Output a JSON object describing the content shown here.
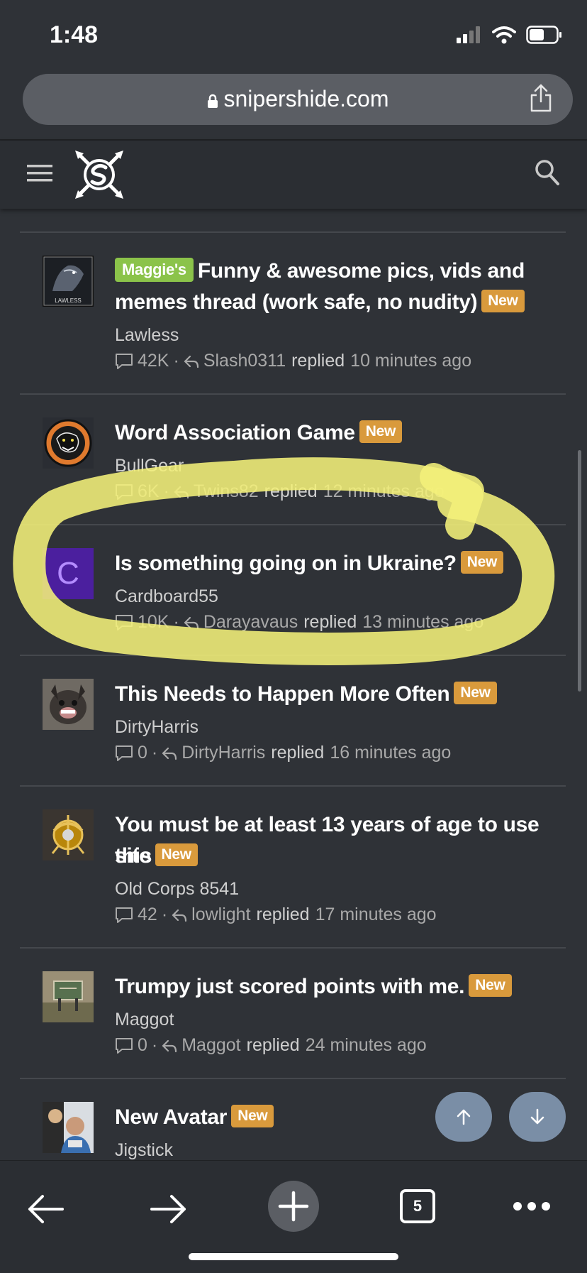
{
  "status_bar": {
    "time": "1:48"
  },
  "browser": {
    "url": "snipershide.com",
    "tabs_count": "5"
  },
  "threads": [
    {
      "prefix": "Maggie's",
      "title_line1": "Funny & awesome pics, vids and",
      "title_line2": "memes thread (work safe, no nudity)",
      "badge": "New",
      "starter": "Lawless",
      "replies": "42K",
      "last_poster": "Slash0311",
      "replied_label": "replied",
      "time": "10 minutes ago",
      "avatar_text": "LAWLESS"
    },
    {
      "title_line1": "Word Association Game",
      "badge": "New",
      "starter": "BullGear",
      "replies": "6K",
      "last_poster": "Twins82",
      "replied_label": "replied",
      "time": "12 minutes ago"
    },
    {
      "title_line1": "Is something going on in Ukraine?",
      "badge": "New",
      "starter": "Cardboard55",
      "replies": "10K",
      "last_poster": "Darayavaus",
      "replied_label": "replied",
      "time": "13 minutes ago",
      "avatar_letter": "C"
    },
    {
      "title_line1": "This Needs to Happen More Often",
      "badge": "New",
      "starter": "DirtyHarris",
      "replies": "0",
      "last_poster": "DirtyHarris",
      "replied_label": "replied",
      "time": "16 minutes ago"
    },
    {
      "title_line1": "You must be at least 13 years of age to use this",
      "title_line2": "site",
      "badge": "New",
      "starter": "Old Corps 8541",
      "replies": "42",
      "last_poster": "lowlight",
      "replied_label": "replied",
      "time": "17 minutes ago"
    },
    {
      "title_line1": "Trumpy just scored points with me.",
      "badge": "New",
      "starter": "Maggot",
      "replies": "0",
      "last_poster": "Maggot",
      "replied_label": "replied",
      "time": "24 minutes ago"
    },
    {
      "title_line1": "New Avatar",
      "badge": "New",
      "starter": "Jigstick"
    }
  ],
  "colors": {
    "background": "#2f3237",
    "new_badge": "#d99a3c",
    "prefix_badge": "#8bc34a",
    "highlight": "#f4f07a",
    "fab": "#7a8ea6"
  },
  "icons": [
    "menu-icon",
    "site-logo",
    "search-icon",
    "share-icon",
    "lock-icon",
    "comment-icon",
    "reply-arrow-icon",
    "arrow-up-icon",
    "arrow-down-icon",
    "back-icon",
    "forward-icon",
    "plus-icon",
    "more-icon"
  ]
}
